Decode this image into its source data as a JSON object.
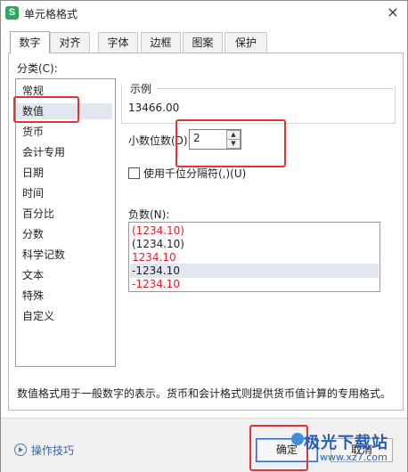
{
  "window": {
    "app_icon": "S",
    "title": "单元格格式",
    "close_icon": "×"
  },
  "tabs": [
    "数字",
    "对齐",
    "字体",
    "边框",
    "图案",
    "保护"
  ],
  "category": {
    "label": "分类(C):",
    "items": [
      "常规",
      "数值",
      "货币",
      "会计专用",
      "日期",
      "时间",
      "百分比",
      "分数",
      "科学记数",
      "文本",
      "特殊",
      "自定义"
    ],
    "selected": "数值"
  },
  "sample": {
    "title": "示例",
    "value": "13466.00"
  },
  "decimal": {
    "label": "小数位数(D):",
    "value": "2"
  },
  "thousands": {
    "label": "使用千位分隔符(,)(U)",
    "checked": false
  },
  "negative": {
    "label": "负数(N):",
    "items": [
      {
        "text": "(1234.10)",
        "red": true
      },
      {
        "text": "(1234.10)",
        "red": false
      },
      {
        "text": "1234.10",
        "red": true
      },
      {
        "text": "-1234.10",
        "red": false
      },
      {
        "text": "-1234.10",
        "red": true
      }
    ],
    "selected_index": 3
  },
  "description": "数值格式用于一般数字的表示。货币和会计格式则提供货币值计算的专用格式。",
  "footer": {
    "tips": "操作技巧",
    "ok": "确定",
    "cancel": "取消"
  },
  "watermark": {
    "title": "极光下载站",
    "url": "www.xz7.com"
  },
  "colors": {
    "accent": "#2ea664",
    "highlight": "#e53333",
    "negative_red": "#e0222b",
    "selection": "#e1e6ef"
  }
}
